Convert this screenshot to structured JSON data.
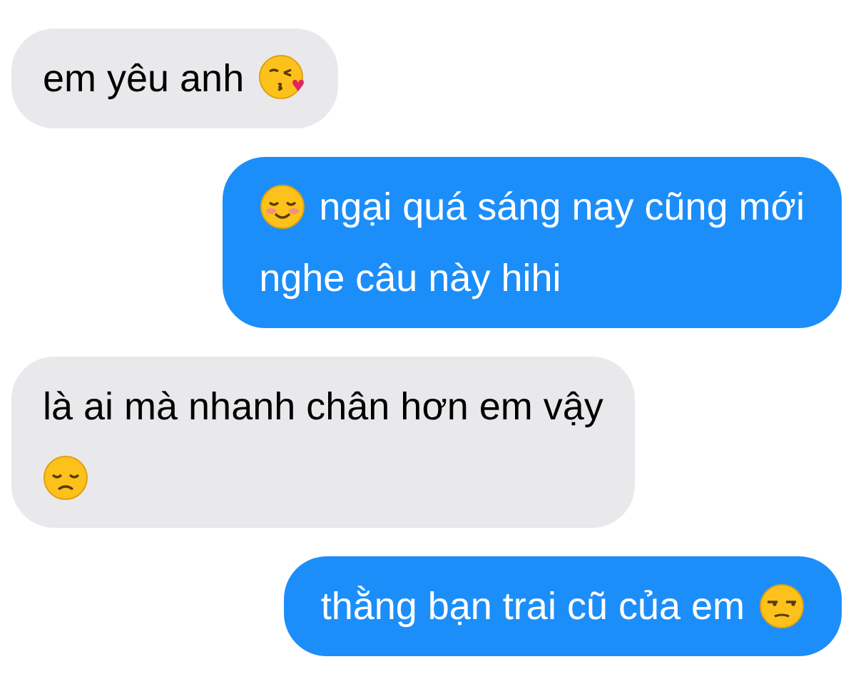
{
  "messages": [
    {
      "kind": "received",
      "lines": [
        [
          {
            "kind": "text",
            "text": "em yêu anh"
          },
          {
            "kind": "kiss"
          }
        ]
      ]
    },
    {
      "kind": "sent",
      "lines": [
        [
          {
            "kind": "blush"
          },
          {
            "kind": "text",
            "text": "ngại quá sáng nay cũng mới"
          }
        ],
        [
          {
            "kind": "text",
            "text": "nghe câu này hihi"
          }
        ]
      ]
    },
    {
      "kind": "received",
      "lines": [
        [
          {
            "kind": "text",
            "text": "là ai mà nhanh chân hơn em vậy"
          }
        ],
        [
          {
            "kind": "sad"
          }
        ]
      ]
    },
    {
      "kind": "sent",
      "lines": [
        [
          {
            "kind": "text",
            "text": "thằng bạn trai cũ của em"
          },
          {
            "kind": "unamused"
          }
        ]
      ]
    }
  ]
}
